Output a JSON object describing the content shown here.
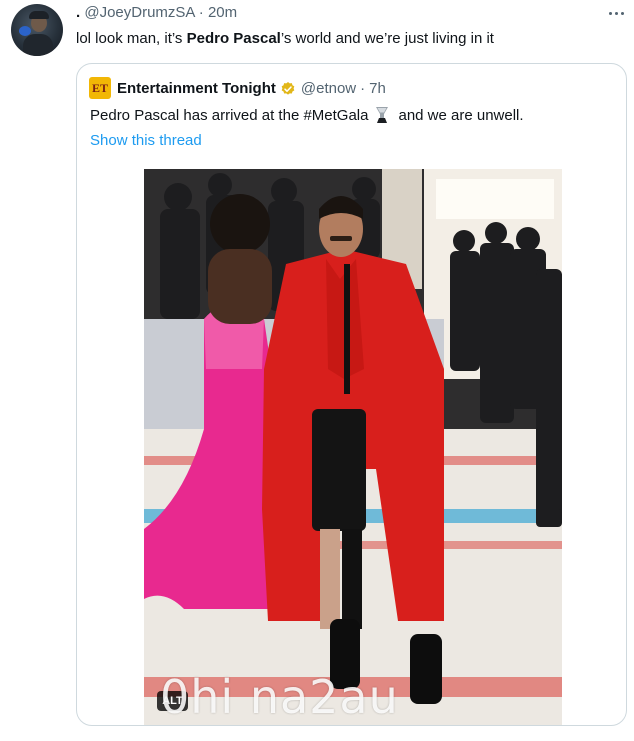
{
  "tweet": {
    "display_name": ".",
    "handle": "@JoeyDrumzSA",
    "separator": "·",
    "time": "20m",
    "text_before": "lol look man, it’s ",
    "text_bold": "Pedro Pascal",
    "text_after": "’s world and we’re just living in it"
  },
  "quoted": {
    "logo": "ET",
    "name": "Entertainment Tonight",
    "handle": "@etnow",
    "separator": "·",
    "time": "7h",
    "text_before": "Pedro Pascal has arrived at the #MetGala",
    "text_after": "and we are unwell.",
    "show_thread": "Show this thread",
    "alt_label": "ALT"
  },
  "watermark": "0hi na2au",
  "icons": {
    "more": "more-horizontal-icon",
    "verified": "verified-gold-badge-icon",
    "emoji": "glass-trophy-emoji-icon"
  },
  "colors": {
    "link": "#1d9bf0",
    "secondary_text": "#536471",
    "border": "#cfd9de",
    "verified_gold": "#e2b719",
    "coat_red": "#d81f1c",
    "dress_pink": "#e8298f"
  }
}
